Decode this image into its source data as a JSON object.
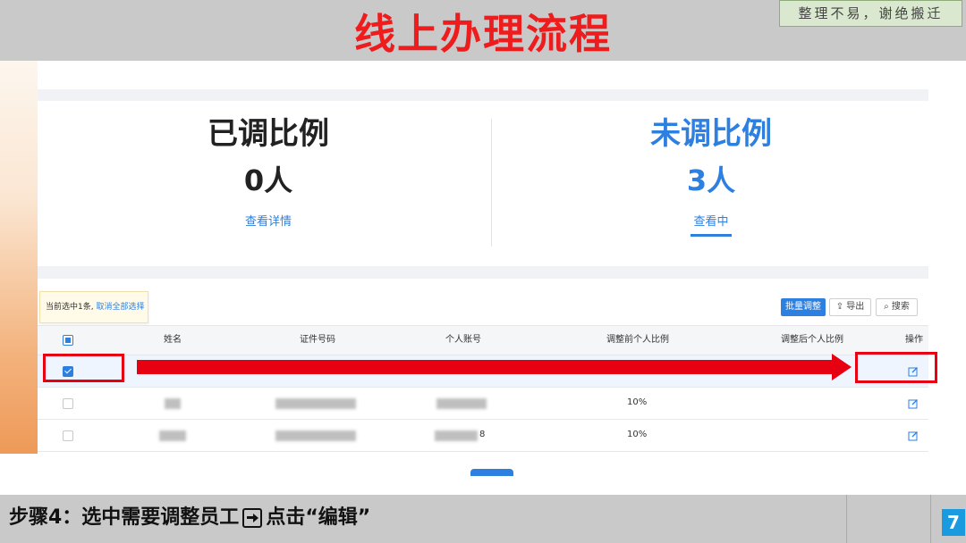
{
  "slide": {
    "title": "线上办理流程",
    "note": "整理不易，谢绝搬迁",
    "footer_step_prefix": "步骤4：选中需要调整员工",
    "footer_step_suffix": "点击“编辑”",
    "page_number": "7"
  },
  "stats": {
    "adjusted": {
      "title": "已调比例",
      "count": "0人",
      "link": "查看详情"
    },
    "unadjusted": {
      "title": "未调比例",
      "count": "3人",
      "link": "查看中"
    }
  },
  "selection_tip": {
    "text": "当前选中1条,",
    "clear_link": "取消全部选择"
  },
  "toolbar": {
    "batch_adjust": "批量调整",
    "export": "导出",
    "search": "搜索"
  },
  "table": {
    "columns": [
      "姓名",
      "证件号码",
      "个人账号",
      "调整前个人比例",
      "调整后个人比例",
      "操作"
    ],
    "rows": [
      {
        "selected": true,
        "before_ratio": ""
      },
      {
        "selected": false,
        "before_ratio": "10%"
      },
      {
        "selected": false,
        "before_ratio": "10%",
        "account_tail": "8"
      }
    ]
  },
  "colors": {
    "accent": "#2d7fe0",
    "highlight_red": "#e60012",
    "title_red": "#ee1c1c"
  }
}
